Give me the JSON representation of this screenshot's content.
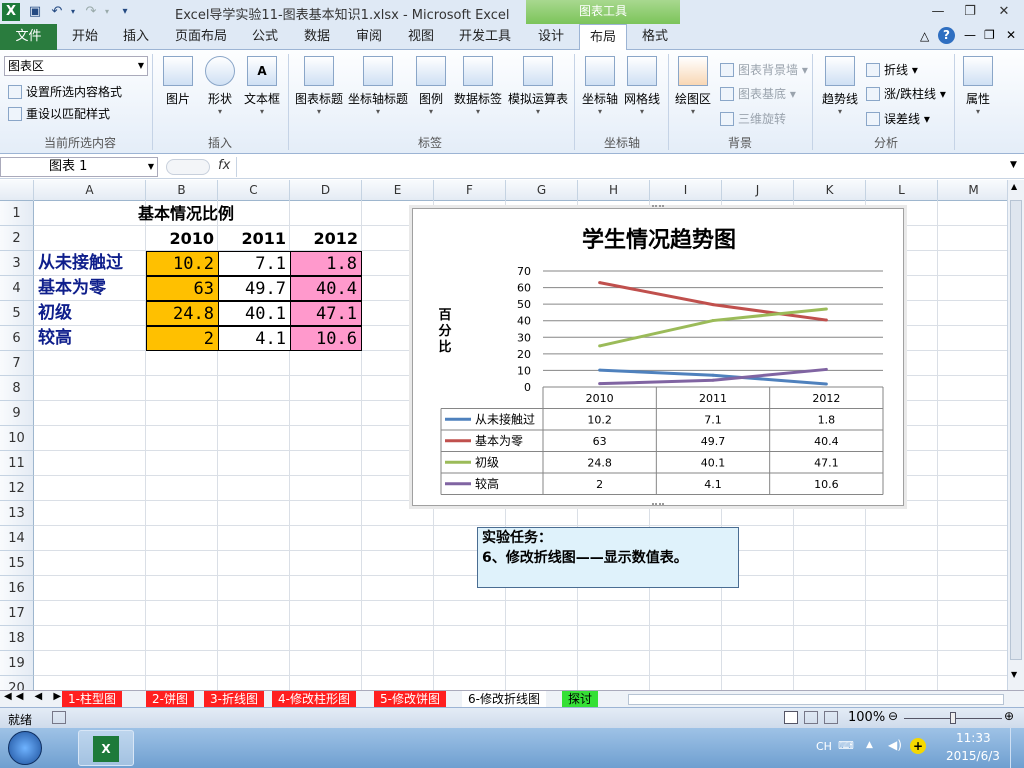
{
  "window": {
    "title": "Excel导学实验11-图表基本知识1.xlsx  -  Microsoft Excel",
    "context_tool": "图表工具"
  },
  "ribbon_tabs": [
    "文件",
    "开始",
    "插入",
    "页面布局",
    "公式",
    "数据",
    "审阅",
    "视图",
    "开发工具",
    "设计",
    "布局",
    "格式"
  ],
  "active_tab": "布局",
  "ribbon": {
    "current_selection": {
      "combo": "图表区",
      "format_btn": "设置所选内容格式",
      "reset_btn": "重设以匹配样式",
      "label": "当前所选内容"
    },
    "insert": {
      "picture": "图片",
      "shapes": "形状",
      "textbox": "文本框",
      "label": "插入"
    },
    "labels": {
      "chart_title": "图表标题",
      "axis_titles": "坐标轴标题",
      "legend": "图例",
      "data_labels": "数据标签",
      "data_table": "模拟运算表",
      "label": "标签"
    },
    "axes": {
      "axes": "坐标轴",
      "gridlines": "网格线",
      "label": "坐标轴"
    },
    "background": {
      "plot_area": "绘图区",
      "chart_wall": "图表背景墙",
      "chart_floor": "图表基底",
      "rotation": "三维旋转",
      "label": "背景"
    },
    "analysis": {
      "trendline": "趋势线",
      "lines": "折线",
      "updown": "涨/跌柱线",
      "errorbars": "误差线",
      "label": "分析"
    },
    "properties": {
      "label": "属性"
    }
  },
  "formula_bar": {
    "name_box": "图表 1",
    "fx": "fx",
    "formula": ""
  },
  "columns": [
    "A",
    "B",
    "C",
    "D",
    "E",
    "F",
    "G",
    "H",
    "I",
    "J",
    "K",
    "L",
    "M"
  ],
  "rows": [
    "1",
    "2",
    "3",
    "4",
    "5",
    "6",
    "7",
    "8",
    "9",
    "10",
    "11",
    "12",
    "13",
    "14",
    "15",
    "16",
    "17",
    "18",
    "19",
    "20"
  ],
  "sheet": {
    "title": "基本情况比例",
    "years": [
      "2010",
      "2011",
      "2012"
    ],
    "rows": [
      {
        "label": "从未接触过",
        "values": [
          "10.2",
          "7.1",
          "1.8"
        ]
      },
      {
        "label": "基本为零",
        "values": [
          "63",
          "49.7",
          "40.4"
        ]
      },
      {
        "label": "初级",
        "values": [
          "24.8",
          "40.1",
          "47.1"
        ]
      },
      {
        "label": "较高",
        "values": [
          "2",
          "4.1",
          "10.6"
        ]
      }
    ],
    "colors": {
      "col_2010": "#ffc000",
      "col_2011": "#ffffff",
      "col_2012": "#ff99cc"
    }
  },
  "chart_data": {
    "type": "line",
    "title": "学生情况趋势图",
    "ylabel": "百分比",
    "xlabel": "",
    "categories": [
      "2010",
      "2011",
      "2012"
    ],
    "ylim": [
      0,
      70
    ],
    "yticks": [
      "0",
      "10",
      "20",
      "30",
      "40",
      "50",
      "60",
      "70"
    ],
    "grid": true,
    "legend": "data-table",
    "series": [
      {
        "name": "从未接触过",
        "values": [
          10.2,
          7.1,
          1.8
        ],
        "color": "#4f81bd",
        "labels": [
          "10.2",
          "7.1",
          "1.8"
        ]
      },
      {
        "name": "基本为零",
        "values": [
          63,
          49.7,
          40.4
        ],
        "color": "#c0504d",
        "labels": [
          "63",
          "49.7",
          "40.4"
        ]
      },
      {
        "name": "初级",
        "values": [
          24.8,
          40.1,
          47.1
        ],
        "color": "#9bbb59",
        "labels": [
          "24.8",
          "40.1",
          "47.1"
        ]
      },
      {
        "name": "较高",
        "values": [
          2,
          4.1,
          10.6
        ],
        "color": "#8064a2",
        "labels": [
          "2",
          "4.1",
          "10.6"
        ]
      }
    ]
  },
  "note": {
    "line1": "实验任务：",
    "line2": "6、修改折线图——显示数值表。"
  },
  "sheet_tabs": [
    {
      "label": "1-柱型图",
      "kind": "red"
    },
    {
      "label": "2-饼图",
      "kind": "red"
    },
    {
      "label": "3-折线图",
      "kind": "red"
    },
    {
      "label": "4-修改柱形图",
      "kind": "red"
    },
    {
      "label": "5-修改饼图",
      "kind": "red"
    },
    {
      "label": "6-修改折线图",
      "kind": "active"
    },
    {
      "label": "探讨",
      "kind": "green"
    }
  ],
  "status": {
    "ready": "就绪",
    "zoom": "100%"
  },
  "taskbar": {
    "ime": "CH",
    "time": "11:33",
    "date": "2015/6/3"
  }
}
